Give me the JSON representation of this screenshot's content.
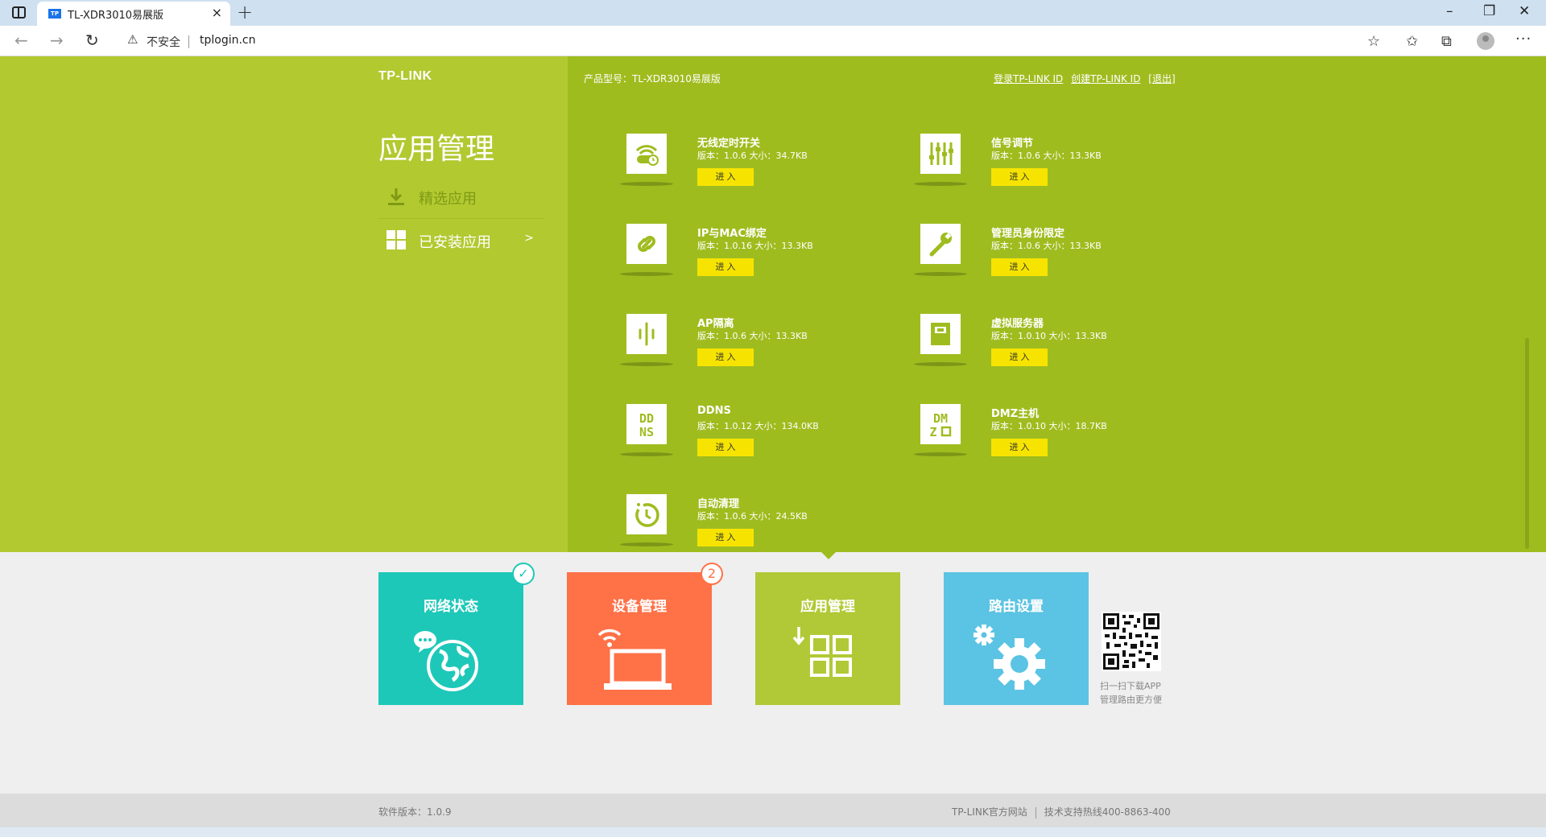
{
  "browser": {
    "tab_title": "TL-XDR3010易展版",
    "tab_favicon": "TP",
    "security_label": "不安全",
    "url": "tplogin.cn"
  },
  "header": {
    "logo": "TP-LINK",
    "product_model": "产品型号：TL-XDR3010易展版",
    "login_link": "登录TP-LINK ID",
    "create_link": "创建TP-LINK ID",
    "logout_link": "[退出]"
  },
  "sidebar": {
    "title": "应用管理",
    "items": [
      {
        "label": "精选应用"
      },
      {
        "label": "已安装应用",
        "arrow": ">"
      }
    ]
  },
  "apps": [
    {
      "name": "无线定时开关",
      "meta": "版本：1.0.6 大小：34.7KB",
      "button": "进 入",
      "icon": "wifi-timer-icon"
    },
    {
      "name": "信号调节",
      "meta": "版本：1.0.6 大小：13.3KB",
      "button": "进 入",
      "icon": "sliders-icon"
    },
    {
      "name": "IP与MAC绑定",
      "meta": "版本：1.0.16 大小：13.3KB",
      "button": "进 入",
      "icon": "link-icon"
    },
    {
      "name": "管理员身份限定",
      "meta": "版本：1.0.6 大小：13.3KB",
      "button": "进 入",
      "icon": "wrench-icon"
    },
    {
      "name": "AP隔离",
      "meta": "版本：1.0.6 大小：13.3KB",
      "button": "进 入",
      "icon": "ap-isolation-icon"
    },
    {
      "name": "虚拟服务器",
      "meta": "版本：1.0.10 大小：13.3KB",
      "button": "进 入",
      "icon": "server-icon"
    },
    {
      "name": "DDNS",
      "meta": "版本：1.0.12 大小：134.0KB",
      "button": "进 入",
      "icon": "ddns-icon",
      "icon_text": [
        "DD",
        "NS"
      ]
    },
    {
      "name": "DMZ主机",
      "meta": "版本：1.0.10 大小：18.7KB",
      "button": "进 入",
      "icon": "dmz-icon",
      "icon_text": [
        "DM",
        "Z"
      ]
    },
    {
      "name": "自动清理",
      "meta": "版本：1.0.6 大小：24.5KB",
      "button": "进 入",
      "icon": "auto-clean-icon"
    }
  ],
  "tiles": [
    {
      "title": "网络状态",
      "badge": "✓",
      "color": "#1ec8b8"
    },
    {
      "title": "设备管理",
      "badge": "2",
      "color": "#ff7147"
    },
    {
      "title": "应用管理",
      "color": "#b1c936"
    },
    {
      "title": "路由设置",
      "color": "#5bc3e3"
    }
  ],
  "qr": {
    "caption_line1": "扫一扫下载APP",
    "caption_line2": "管理路由更方便"
  },
  "footer": {
    "version": "软件版本：1.0.9",
    "official_site": "TP-LINK官方网站",
    "hotline": "技术支持热线400-8863-400"
  },
  "colors": {
    "left_panel": "#b2c930",
    "right_panel": "#9fbc1f",
    "enter_button": "#f6e400"
  }
}
